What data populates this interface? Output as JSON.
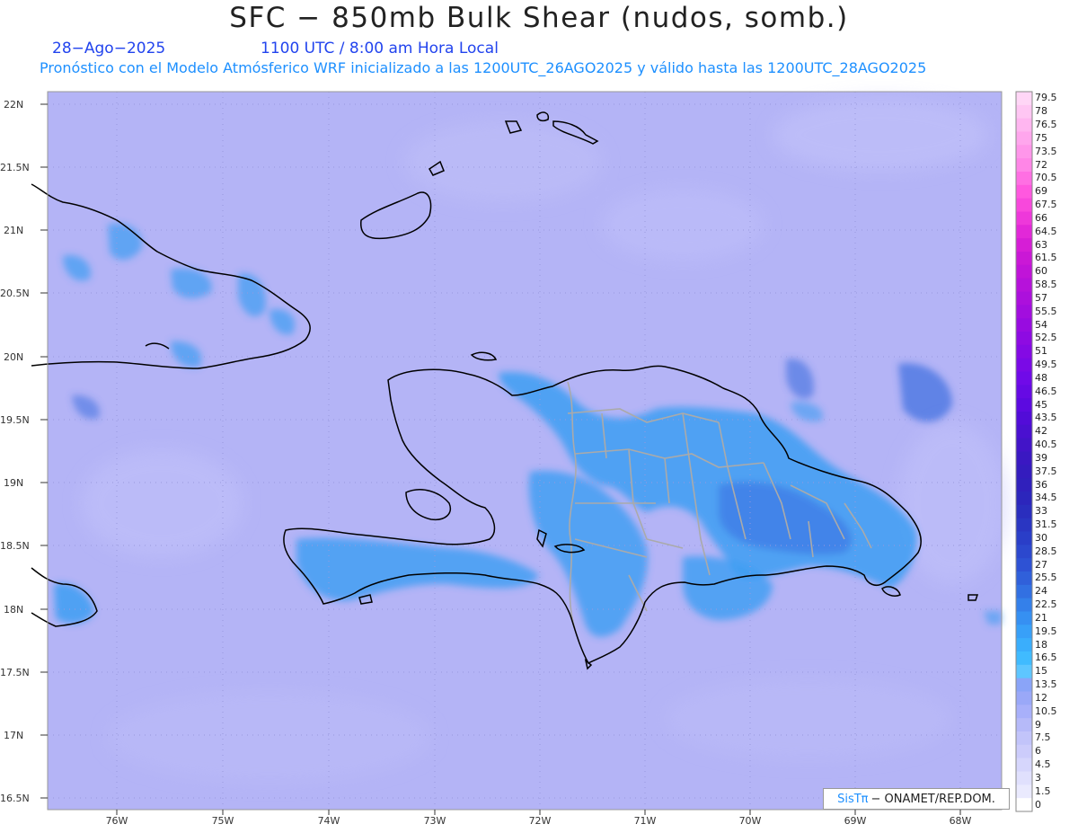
{
  "header": {
    "title": "SFC − 850mb Bulk Shear (nudos, somb.)",
    "date": "28−Ago−2025",
    "time": "1100 UTC / 8:00 am Hora Local",
    "subtitle": "Pronóstico con el Modelo Atmósferico WRF inicializado a las 1200UTC_26AGO2025 y válido hasta las  1200UTC_28AGO2025"
  },
  "axes": {
    "lat_labels": [
      "22N",
      "21.5N",
      "21N",
      "20.5N",
      "20N",
      "19.5N",
      "19N",
      "18.5N",
      "18N",
      "17.5N",
      "17N",
      "16.5N"
    ],
    "lon_labels": [
      "76W",
      "75W",
      "74W",
      "73W",
      "72W",
      "71W",
      "70W",
      "69W",
      "68W"
    ]
  },
  "colorbar": {
    "labels": [
      "79.5",
      "78",
      "76.5",
      "75",
      "73.5",
      "72",
      "70.5",
      "69",
      "67.5",
      "66",
      "64.5",
      "63",
      "61.5",
      "60",
      "58.5",
      "57",
      "55.5",
      "54",
      "52.5",
      "51",
      "49.5",
      "48",
      "46.5",
      "45",
      "43.5",
      "42",
      "40.5",
      "39",
      "37.5",
      "36",
      "34.5",
      "33",
      "31.5",
      "30",
      "28.5",
      "27",
      "25.5",
      "24",
      "22.5",
      "21",
      "19.5",
      "18",
      "16.5",
      "15",
      "13.5",
      "12",
      "10.5",
      "9",
      "7.5",
      "6",
      "4.5",
      "3",
      "1.5",
      "0"
    ],
    "colors": [
      "#ffd6f6",
      "#ffc6f3",
      "#ffb6f0",
      "#ffa6ed",
      "#ff96ea",
      "#ff86e7",
      "#ff6fe3",
      "#ff58df",
      "#f848dc",
      "#ee38da",
      "#e228d8",
      "#d61ed6",
      "#ca18d6",
      "#c014d8",
      "#b612da",
      "#ac10dc",
      "#a20ede",
      "#980ce0",
      "#8e0be2",
      "#840ae4",
      "#7a0ae6",
      "#700ae8",
      "#660ae4",
      "#5c0ae0",
      "#520cd8",
      "#4a10d0",
      "#4214c8",
      "#3a18c2",
      "#341cbe",
      "#3020bc",
      "#2c26bc",
      "#2a2ebe",
      "#2a36c2",
      "#2a3ec8",
      "#2c48ce",
      "#2e52d4",
      "#3060da",
      "#3270e2",
      "#3480ea",
      "#3690f2",
      "#38a0f8",
      "#3aaefc",
      "#40bbff",
      "#5ec6ff",
      "#8aa4f8",
      "#9aa8f8",
      "#a8b0fa",
      "#b6baf9",
      "#c2c4fa",
      "#ccccfb",
      "#d6d6fc",
      "#e0e0fd",
      "#eaeafe",
      "#ffffff"
    ]
  },
  "credit": {
    "brand": "SisTπ",
    "text": "− ONAMET/REP.DOM."
  },
  "colors": {
    "background": "#b4b4f6",
    "shade_moderate": "#3c9df2",
    "shade_strong": "#3a6ee0",
    "coast": "#000000",
    "borders": "#aaaaaa"
  }
}
